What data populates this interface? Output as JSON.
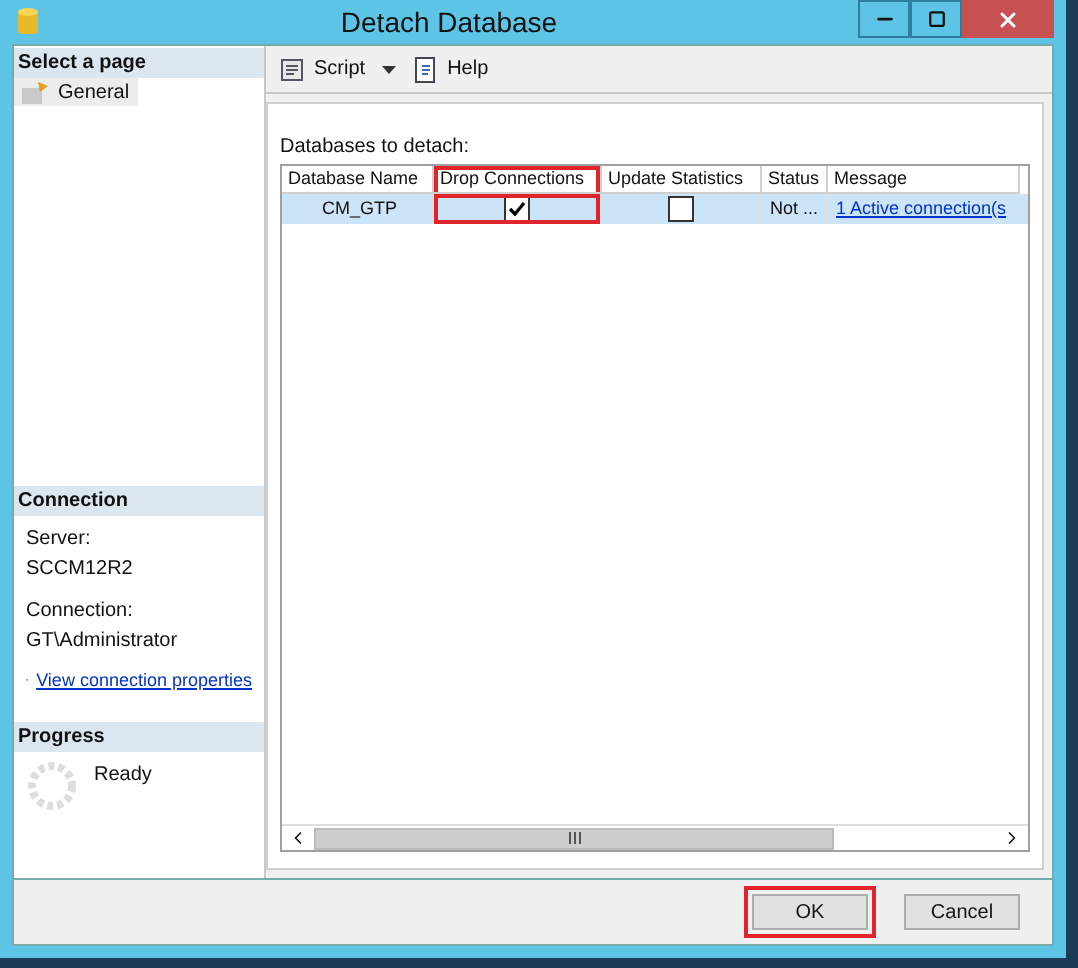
{
  "window": {
    "title": "Detach Database"
  },
  "sidebar": {
    "header": "Select a page",
    "items": [
      {
        "label": "General",
        "selected": true
      }
    ]
  },
  "connection": {
    "header": "Connection",
    "server_label": "Server:",
    "server": "SCCM12R2",
    "connection_label": "Connection:",
    "connection": "GT\\Administrator",
    "link": "View connection properties"
  },
  "progress": {
    "header": "Progress",
    "status": "Ready"
  },
  "toolbar": [
    {
      "kind": "script",
      "label": "Script"
    },
    {
      "kind": "help",
      "label": "Help"
    }
  ],
  "grid": {
    "label": "Databases to detach:",
    "columns": [
      {
        "label": "Database Name",
        "highlighted": false
      },
      {
        "label": "Drop Connections",
        "highlighted": true
      },
      {
        "label": "Update Statistics",
        "highlighted": false
      },
      {
        "label": "Status",
        "highlighted": false
      },
      {
        "label": "Message",
        "highlighted": false
      }
    ],
    "rows": [
      {
        "name": "CM_GTP",
        "selected": true,
        "drop_connections": true,
        "update_statistics": false,
        "status": "Not ...",
        "message": "1 Active connection(s"
      }
    ]
  },
  "buttons": [
    {
      "label": "OK",
      "highlighted": true
    },
    {
      "label": "Cancel",
      "highlighted": false
    }
  ]
}
